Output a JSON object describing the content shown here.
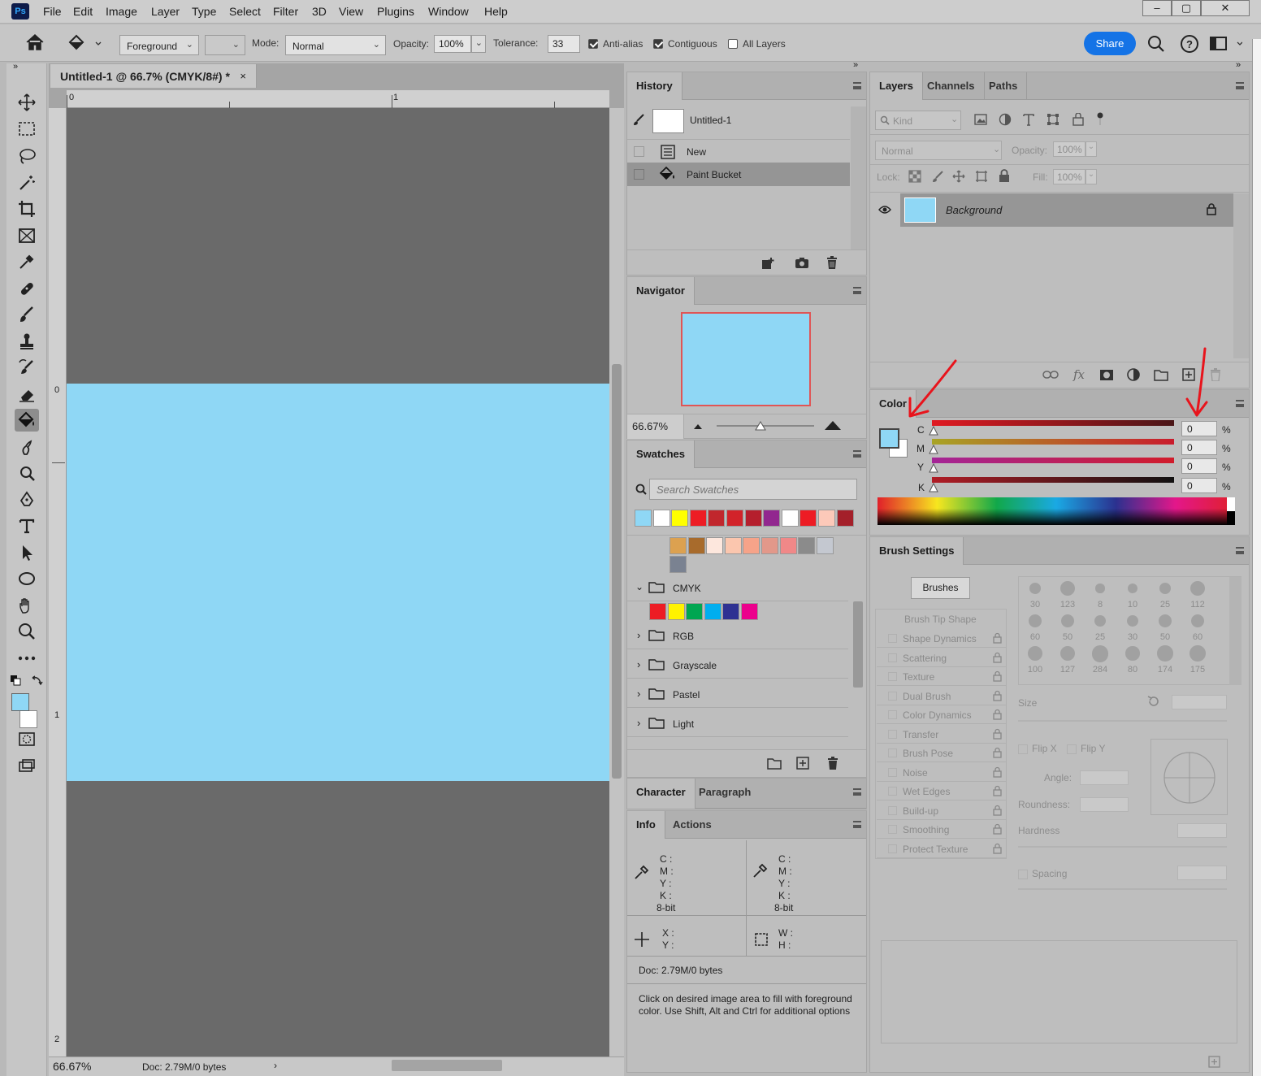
{
  "app": {
    "logo": "Ps",
    "menu": [
      "File",
      "Edit",
      "Image",
      "Layer",
      "Type",
      "Select",
      "Filter",
      "3D",
      "View",
      "Plugins",
      "Window",
      "Help"
    ]
  },
  "options": {
    "fill_source": "Foreground",
    "mode_label": "Mode:",
    "mode_value": "Normal",
    "opacity_label": "Opacity:",
    "opacity_value": "100%",
    "tolerance_label": "Tolerance:",
    "tolerance_value": "33",
    "antialias_label": "Anti-alias",
    "contiguous_label": "Contiguous",
    "alllayers_label": "All Layers",
    "share_label": "Share"
  },
  "document": {
    "tab_title": "Untitled-1 @ 66.7% (CMYK/8#) *",
    "ruler_top": [
      "0",
      "1"
    ],
    "ruler_left": [
      "0",
      "1",
      "2"
    ],
    "zoom": "66.67%",
    "doc_info": "Doc: 2.79M/0 bytes",
    "canvas_color": "#8fd7f5",
    "pasteboard_color": "#6a6a6a"
  },
  "history": {
    "tab": "History",
    "snapshot": "Untitled-1",
    "states": [
      "New",
      "Paint Bucket"
    ]
  },
  "navigator": {
    "tab": "Navigator",
    "zoom": "66.67%"
  },
  "swatches": {
    "tab": "Swatches",
    "search_placeholder": "Search Swatches",
    "recent": [
      "#8fd7f5",
      "#ffffff",
      "#ffff00",
      "#ed1c24",
      "#c1272d",
      "#d2232a",
      "#b51f2d",
      "#92278f",
      "#ffffff",
      "#ed1c24",
      "#fcc9b9",
      "#a4202a"
    ],
    "row2": [
      "#dca150",
      "#a86b2c",
      "#fde7dd",
      "#fbc6ae",
      "#f6a389",
      "#e2988a",
      "#f08888",
      "#8b8b8b",
      "#c4c8d0"
    ],
    "row3": [
      "#7a8291"
    ],
    "cmyk_colors": [
      "#ed1c24",
      "#fff200",
      "#00a651",
      "#00aeef",
      "#2e3192",
      "#ec008c"
    ],
    "folders": [
      "CMYK",
      "RGB",
      "Grayscale",
      "Pastel",
      "Light"
    ]
  },
  "character": {
    "tabs": [
      "Character",
      "Paragraph"
    ]
  },
  "info": {
    "tabs": [
      "Info",
      "Actions"
    ],
    "cmyk_labels": [
      "C :",
      "M :",
      "Y :",
      "K :"
    ],
    "bit": "8-bit",
    "xy": [
      "X :",
      "Y :"
    ],
    "wh": [
      "W :",
      "H :"
    ],
    "doc": "Doc: 2.79M/0 bytes",
    "hint": "Click on desired image area to fill with foreground color.  Use Shift, Alt and Ctrl for additional options"
  },
  "layers": {
    "tabs": [
      "Layers",
      "Channels",
      "Paths"
    ],
    "kind": "Kind",
    "blend": "Normal",
    "opacity_label": "Opacity:",
    "opacity": "100%",
    "lock_label": "Lock:",
    "fill_label": "Fill:",
    "fill": "100%",
    "layer_name": "Background",
    "layer_thumb": "#8fd7f5"
  },
  "color": {
    "tab": "Color",
    "fg": "#8fd7f5",
    "bg": "#ffffff",
    "channels": [
      {
        "label": "C",
        "value": "0"
      },
      {
        "label": "M",
        "value": "0"
      },
      {
        "label": "Y",
        "value": "0"
      },
      {
        "label": "K",
        "value": "0"
      }
    ],
    "unit": "%",
    "annotation_color": "#e8141c"
  },
  "brush_settings": {
    "tab": "Brush Settings",
    "brushes_button": "Brushes",
    "tip_shape": "Brush Tip Shape",
    "items": [
      "Shape Dynamics",
      "Scattering",
      "Texture",
      "Dual Brush",
      "Color Dynamics",
      "Transfer",
      "Brush Pose",
      "Noise",
      "Wet Edges",
      "Build-up",
      "Smoothing",
      "Protect Texture"
    ],
    "brush_sizes": [
      "30",
      "123",
      "8",
      "10",
      "25",
      "112",
      "60",
      "50",
      "25",
      "30",
      "50",
      "60",
      "100",
      "127",
      "284",
      "80",
      "174",
      "175"
    ],
    "size_label": "Size",
    "flipx": "Flip X",
    "flipy": "Flip Y",
    "angle": "Angle:",
    "roundness": "Roundness:",
    "hardness": "Hardness",
    "spacing": "Spacing"
  }
}
